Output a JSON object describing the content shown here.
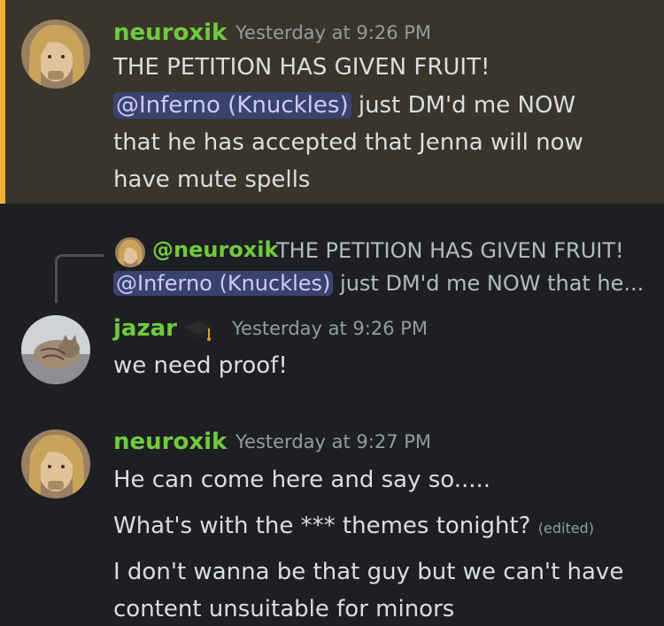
{
  "messages": [
    {
      "username": "neuroxik",
      "timestamp": "Yesterday at 9:26 PM",
      "line1": "THE PETITION HAS GIVEN FRUIT!",
      "mention": "@Inferno (Knuckles)",
      "line2_after_mention": " just DM'd me NOW",
      "line3": "that he has accepted that Jenna will now",
      "line4": "have mute spells"
    },
    {
      "reply": {
        "username": "@neuroxik",
        "text1": "THE PETITION HAS GIVEN FRUIT!",
        "mention": "@Inferno (Knuckles)",
        "text2": " just DM'd me NOW that he..."
      },
      "username": "jazar",
      "badge_icon": "graduation-cap-icon",
      "timestamp": "Yesterday at 9:26 PM",
      "text": "we need proof!"
    },
    {
      "username": "neuroxik",
      "timestamp": "Yesterday at 9:27 PM",
      "line1": "He can come here and say so.....",
      "line2": "What's with the *** themes tonight?",
      "edited": "(edited)",
      "line3": "I don't wanna be that guy but we can't have",
      "line4": "content unsuitable for minors"
    }
  ],
  "colors": {
    "background": "#1e1f22",
    "highlight_background": "#39352a",
    "highlight_border": "#f0b232",
    "username": "#6fcb3e",
    "mention_bg": "#3c4270",
    "mention_text": "#c9cdfb",
    "timestamp": "#949ba4"
  }
}
